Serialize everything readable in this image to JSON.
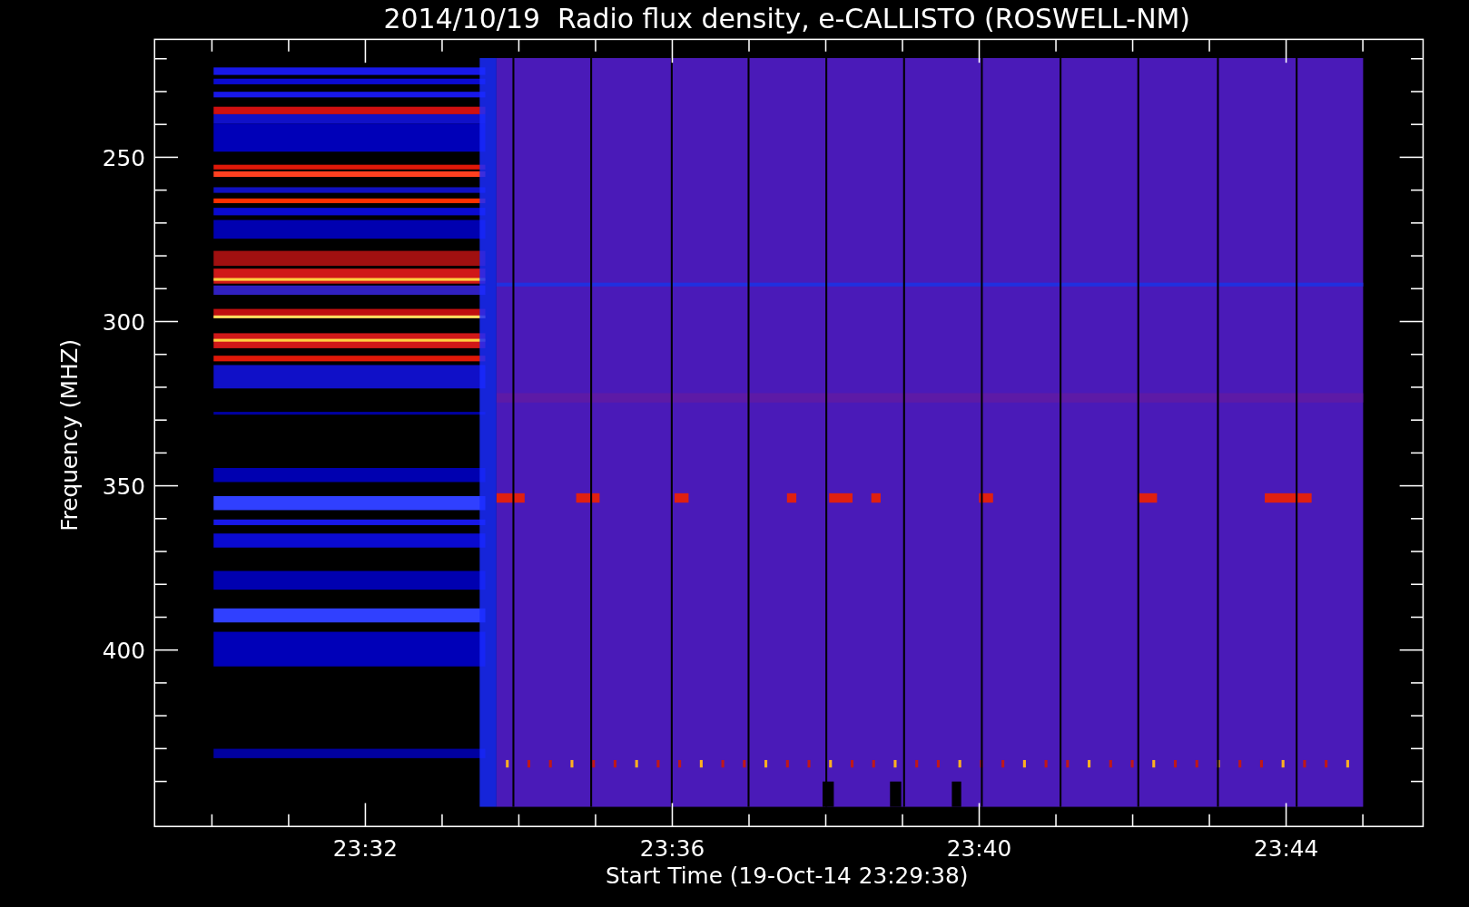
{
  "title": "2014/10/19  Radio flux density, e-CALLISTO (ROSWELL-NM)",
  "xaxis": {
    "label": "Start Time (19-Oct-14 23:29:38)",
    "ticks": [
      "23:32",
      "23:36",
      "23:40",
      "23:44"
    ]
  },
  "yaxis": {
    "label": "Frequency (MHZ)",
    "ticks": [
      "250",
      "300",
      "350",
      "400"
    ]
  }
}
